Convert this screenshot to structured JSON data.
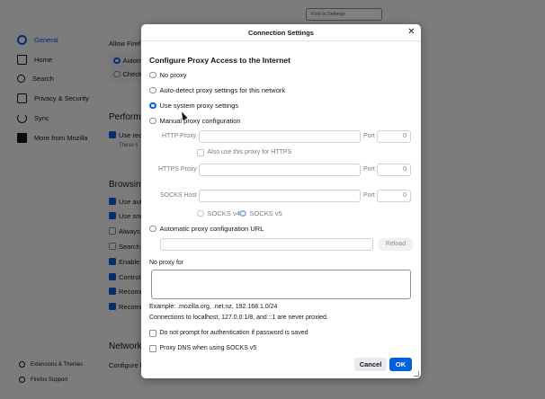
{
  "background": {
    "find_placeholder": "Find in Settings",
    "sidebar": [
      {
        "label": "General",
        "icon": "gear-icon",
        "active": true
      },
      {
        "label": "Home",
        "icon": "home-icon"
      },
      {
        "label": "Search",
        "icon": "search-icon"
      },
      {
        "label": "Privacy & Security",
        "icon": "lock-icon"
      },
      {
        "label": "Sync",
        "icon": "sync-icon"
      },
      {
        "label": "More from Mozilla",
        "icon": "mozilla-icon"
      }
    ],
    "footer": [
      {
        "label": "Extensions & Themes",
        "icon": "puzzle-icon"
      },
      {
        "label": "Firefox Support",
        "icon": "help-icon"
      }
    ],
    "content": {
      "allow_label": "Allow Firef",
      "auto_label": "Autom",
      "check_label": "Check",
      "performance_heading": "Perform",
      "use_rec": "Use rec",
      "these_s": "These s",
      "browsing_heading": "Browsing",
      "items": [
        "Use auto",
        "Use smo",
        "Always u",
        "Search f",
        "Enable p",
        "Control",
        "Recomm",
        "Recomm"
      ],
      "network_heading": "Network",
      "configure": "Configure h"
    },
    "accent_color": "#0061e0"
  },
  "dialog": {
    "title": "Connection Settings",
    "heading": "Configure Proxy Access to the Internet",
    "options": {
      "no_proxy": "No proxy",
      "auto_detect": "Auto-detect proxy settings for this network",
      "system": "Use system proxy settings",
      "manual": "Manual proxy configuration",
      "auto_url": "Automatic proxy configuration URL"
    },
    "selected_option": "system",
    "http_proxy_label": "HTTP Proxy",
    "https_proxy_label": "HTTPS Proxy",
    "socks_host_label": "SOCKS Host",
    "port_label": "Port",
    "http_port": "0",
    "https_port": "0",
    "socks_port": "0",
    "also_https": "Also use this proxy for HTTPS",
    "socks_v4": "SOCKS v4",
    "socks_v5": "SOCKS v5",
    "reload": "Reload",
    "no_proxy_for": "No proxy for",
    "example": "Example: .mozilla.org, .net.nz, 192.168.1.0/24",
    "localhost_note": "Connections to localhost, 127.0.0.1/8, and ::1 are never proxied.",
    "no_prompt": "Do not prompt for authentication if password is saved",
    "proxy_dns": "Proxy DNS when using SOCKS v5",
    "cancel": "Cancel",
    "ok": "OK"
  }
}
